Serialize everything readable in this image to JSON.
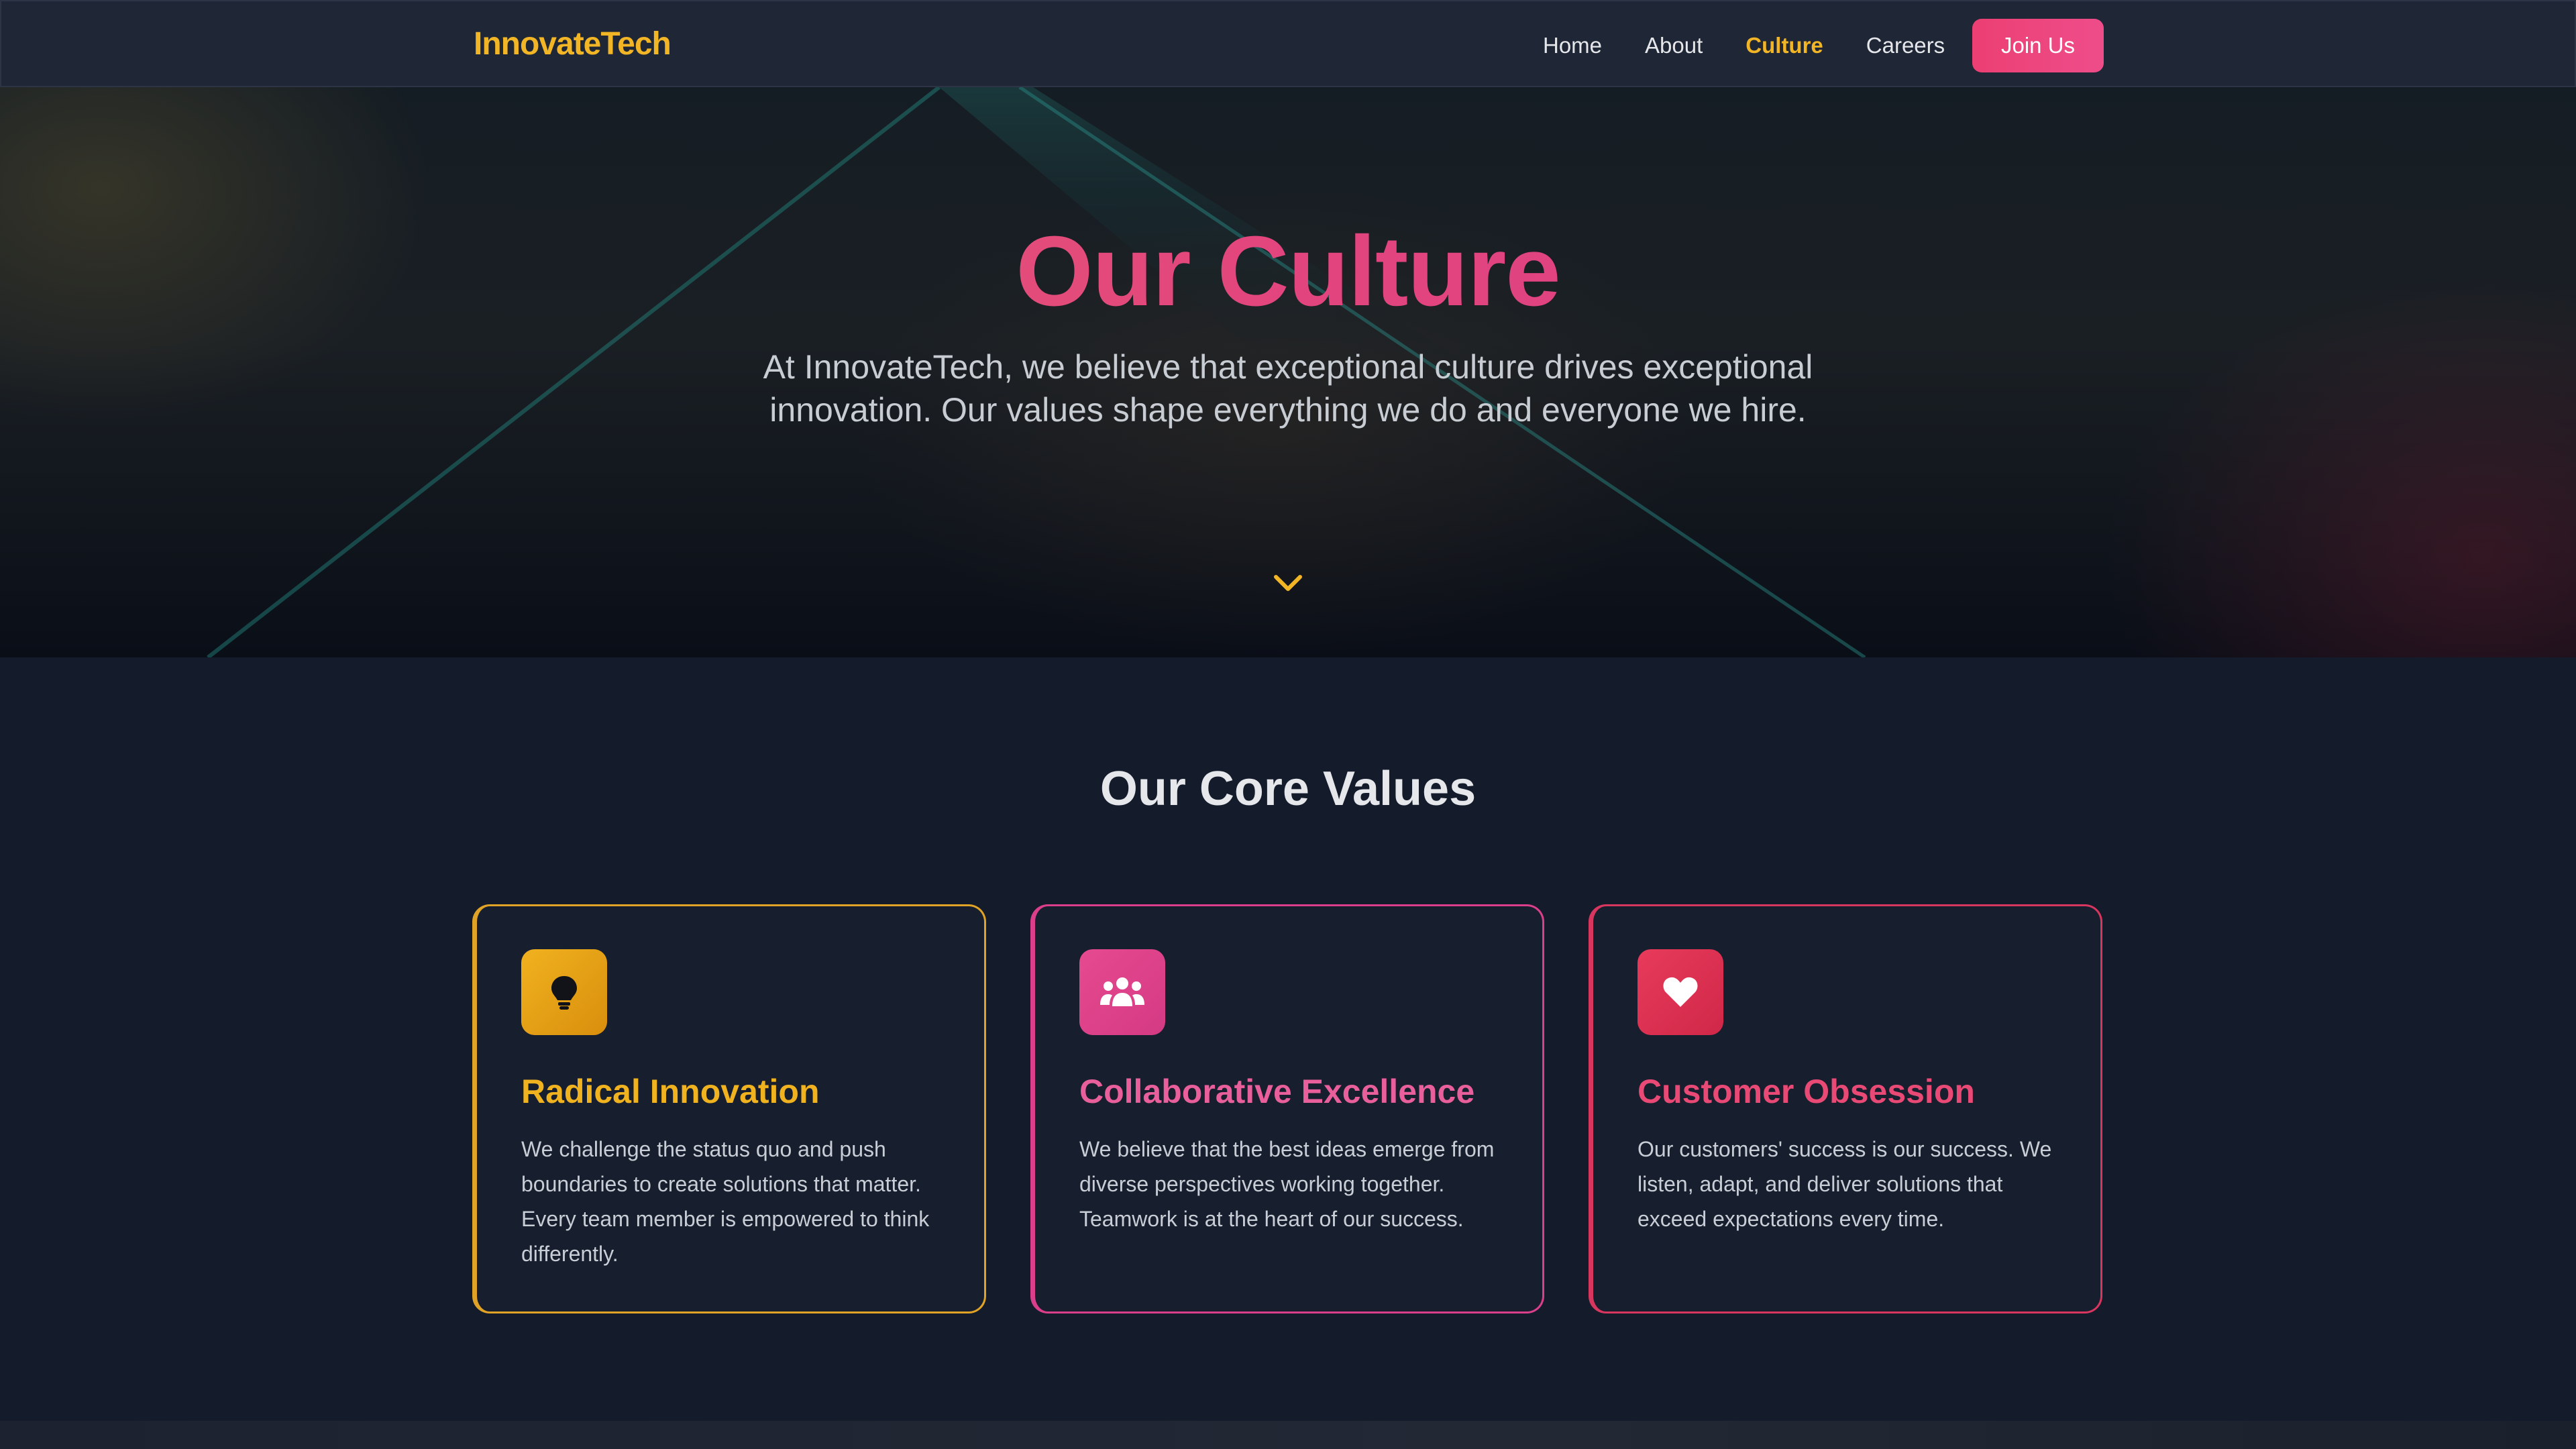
{
  "nav": {
    "brand": "InnovateTech",
    "links": [
      {
        "label": "Home"
      },
      {
        "label": "About"
      },
      {
        "label": "Culture",
        "active": true
      },
      {
        "label": "Careers"
      }
    ],
    "cta_label": "Join Us"
  },
  "hero": {
    "title": "Our Culture",
    "subtitle": "At InnovateTech, we believe that exceptional culture drives exceptional innovation. Our values shape everything we do and everyone we hire.",
    "scroll_icon": "chevron-down-icon"
  },
  "values": {
    "title": "Our Core Values",
    "cards": [
      {
        "icon": "lightbulb-icon",
        "title": "Radical Innovation",
        "text": "We challenge the status quo and push boundaries to create solutions that matter. Every team member is empowered to think differently."
      },
      {
        "icon": "users-icon",
        "title": "Collaborative Excellence",
        "text": "We believe that the best ideas emerge from diverse perspectives working together. Teamwork is at the heart of our success."
      },
      {
        "icon": "heart-icon",
        "title": "Customer Obsession",
        "text": "Our customers' success is our success. We listen, adapt, and deliver solutions that exceed expectations every time."
      }
    ]
  },
  "colors": {
    "accent_gold": "#f2b526",
    "accent_pink": "#ec3f73",
    "background": "#141b2b",
    "nav_bg": "#1f2736"
  }
}
